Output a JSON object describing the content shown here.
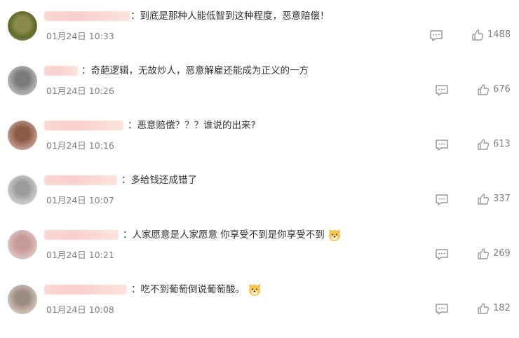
{
  "comments": [
    {
      "text": "：到底是那种人能低智到这种程度，恶意赔偿！",
      "time": "01月24日 10:33",
      "likes": "1488",
      "emoji": false
    },
    {
      "text": "：奇葩逻辑，无故炒人，恶意解雇还能成为正义的一方",
      "time": "01月24日 10:26",
      "likes": "676",
      "emoji": false
    },
    {
      "text": "：恶意赔偿？？？谁说的出来?",
      "time": "01月24日 10:16",
      "likes": "613",
      "emoji": false
    },
    {
      "text": "：多给钱还成错了",
      "time": "01月24日 10:07",
      "likes": "337",
      "emoji": false
    },
    {
      "text": "：人家愿意是人家愿意 你享受不到是你享受不到",
      "time": "01月24日 10:21",
      "likes": "269",
      "emoji": true
    },
    {
      "text": "：吃不到葡萄倒说葡萄酸。",
      "time": "01月24日 10:08",
      "likes": "182",
      "emoji": true
    }
  ],
  "icons": {
    "avatar": "avatar-image",
    "reply": "comment-bubble-icon",
    "like": "thumbs-up-icon",
    "emoji": "dog-face-emoji"
  },
  "colors": {
    "text": "#333333",
    "meta": "#808080",
    "icon": "#9a9a9a",
    "name_blur": "#f9d3ce"
  }
}
